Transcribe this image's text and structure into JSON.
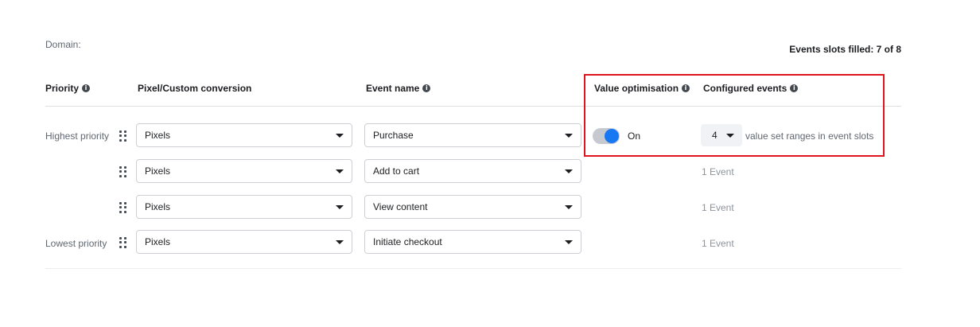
{
  "domain": {
    "label": "Domain:"
  },
  "slots": {
    "label": "Events slots filled: 7 of 8"
  },
  "header": {
    "priority": "Priority",
    "pixel": "Pixel/Custom conversion",
    "event": "Event name",
    "value": "Value optimisation",
    "configured": "Configured events"
  },
  "rows": [
    {
      "priority": "Highest priority",
      "pixel": "Pixels",
      "event": "Purchase",
      "toggle_label": "On",
      "value_sets": "4",
      "value_suffix": "value set ranges in event slots"
    },
    {
      "priority": "",
      "pixel": "Pixels",
      "event": "Add to cart",
      "configured": "1 Event"
    },
    {
      "priority": "",
      "pixel": "Pixels",
      "event": "View content",
      "configured": "1 Event"
    },
    {
      "priority": "Lowest priority",
      "pixel": "Pixels",
      "event": "Initiate checkout",
      "configured": "1 Event"
    }
  ],
  "icons": {
    "info": "info-icon",
    "drag": "drag-handle-icon",
    "caret": "caret-down-icon"
  },
  "colors": {
    "accent": "#1877f2",
    "highlight": "#e0141e"
  },
  "toggle": {
    "value_optimisation_on": true
  }
}
